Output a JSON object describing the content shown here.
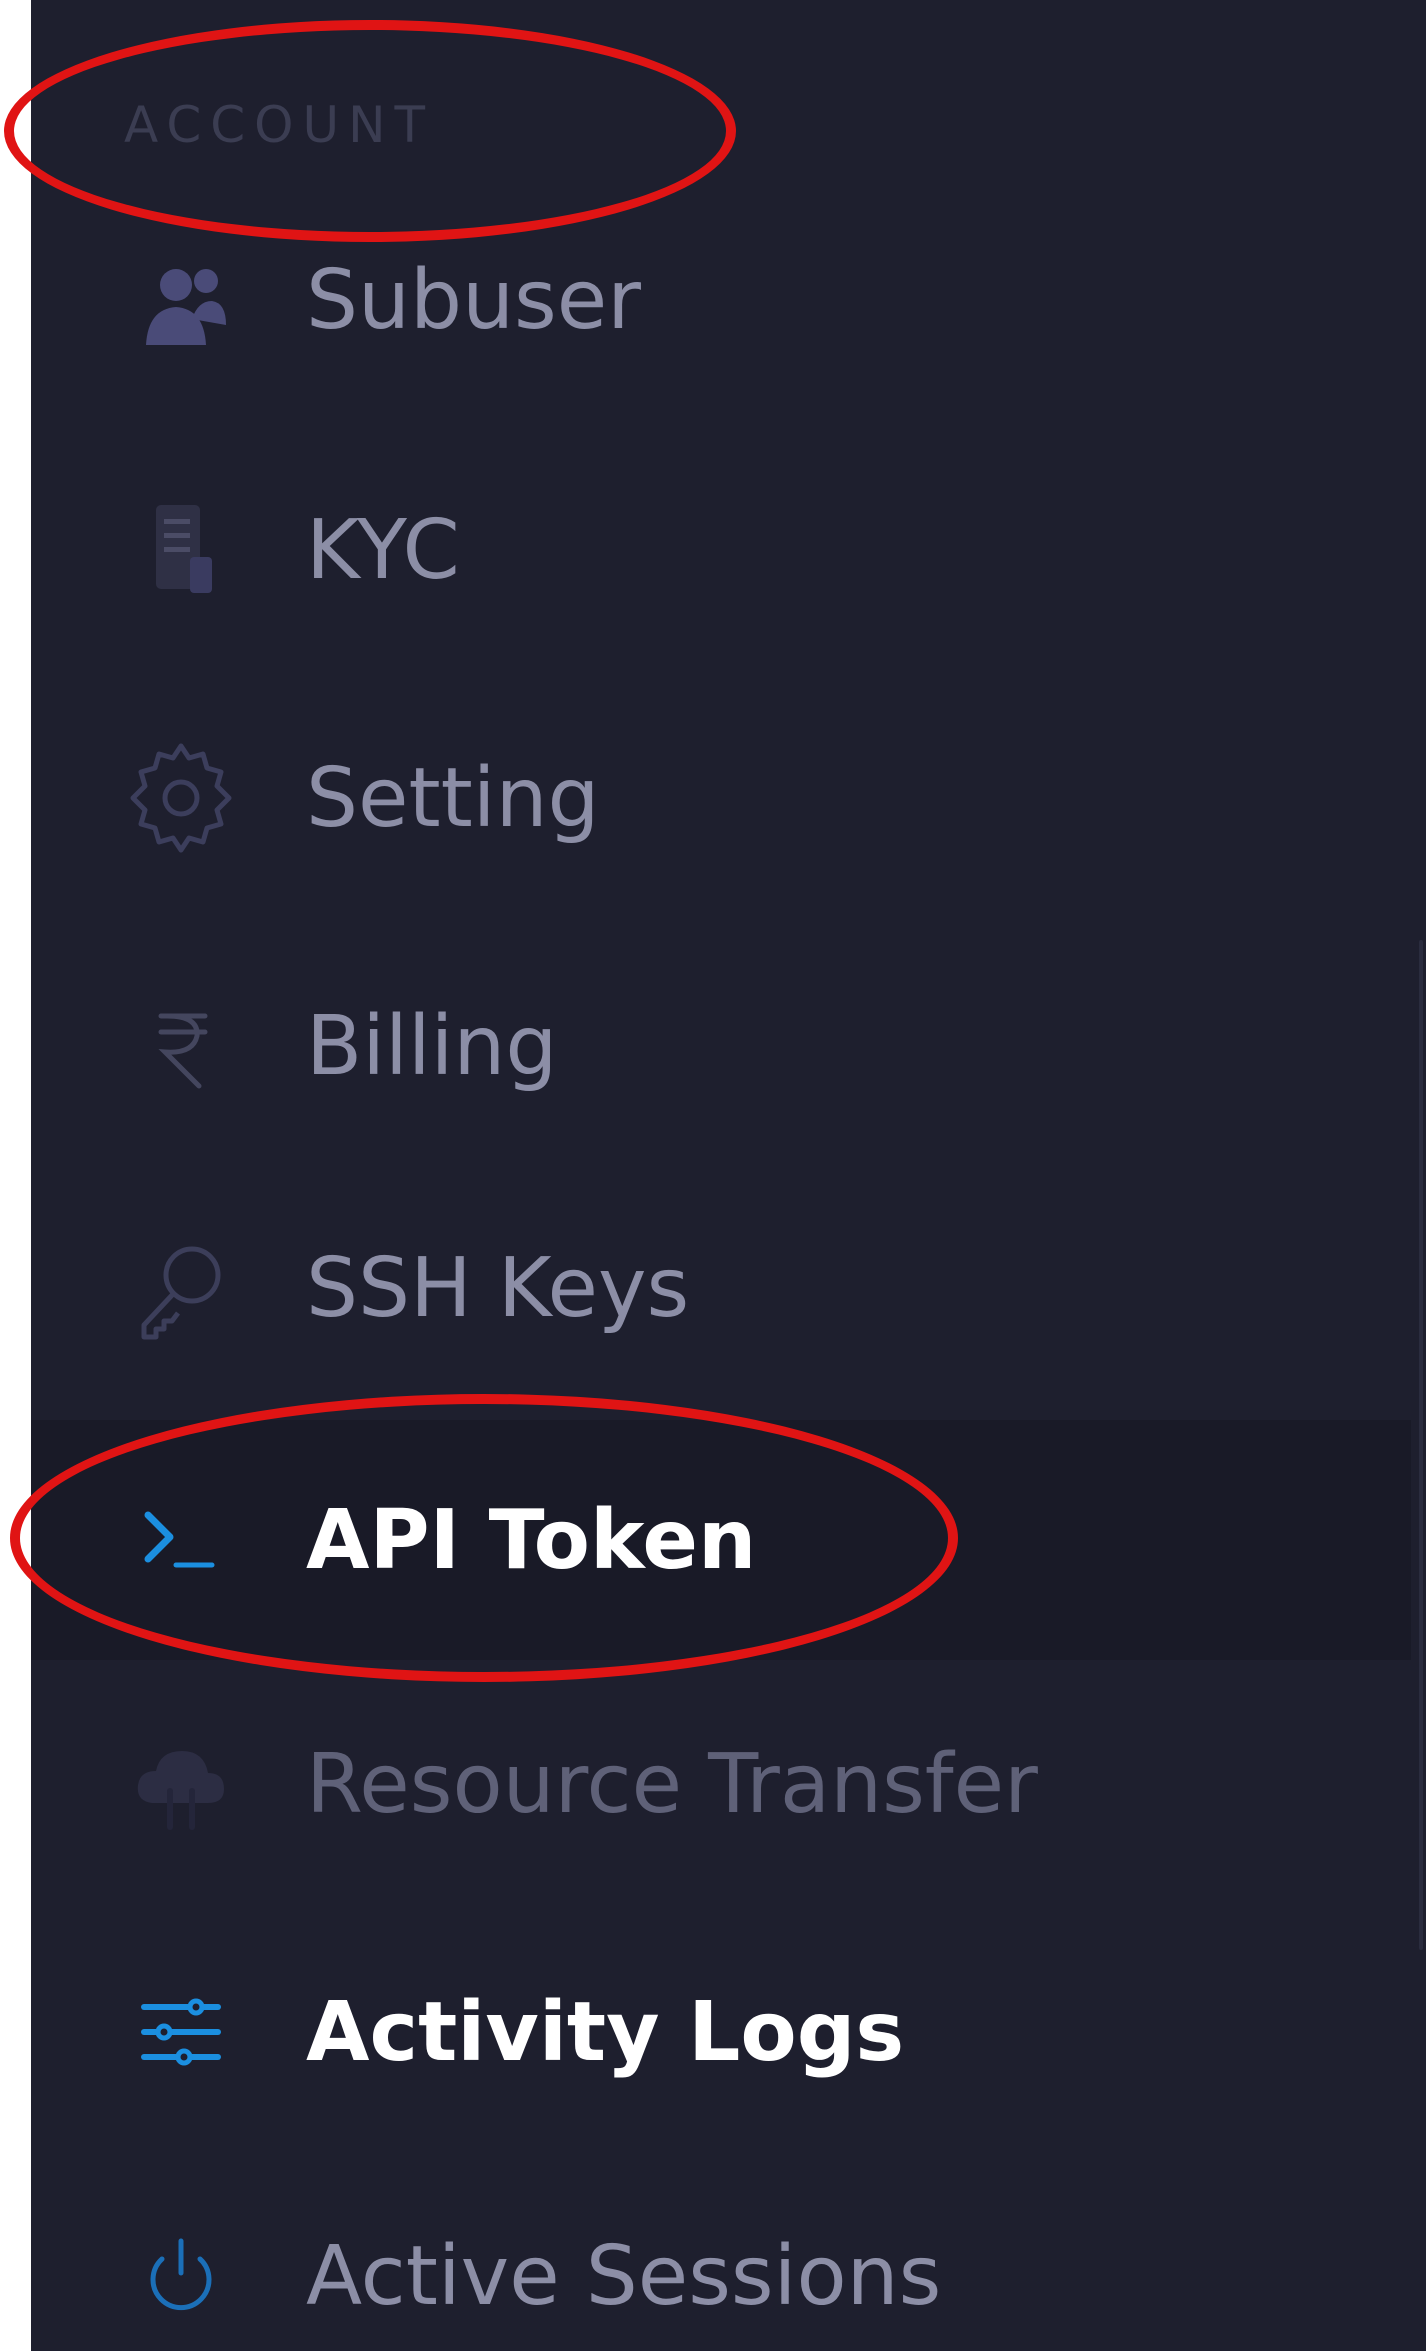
{
  "sidebar": {
    "section_title": "ACCOUNT",
    "items": [
      {
        "label": "Subuser",
        "icon": "users-icon"
      },
      {
        "label": "KYC",
        "icon": "document-icon"
      },
      {
        "label": "Setting",
        "icon": "gear-icon"
      },
      {
        "label": "Billing",
        "icon": "rupee-icon"
      },
      {
        "label": "SSH Keys",
        "icon": "key-icon"
      },
      {
        "label": "API Token",
        "icon": "terminal-icon",
        "active": true
      },
      {
        "label": "Resource Transfer",
        "icon": "cloud-transfer-icon"
      },
      {
        "label": "Activity Logs",
        "icon": "sliders-icon"
      },
      {
        "label": "Active Sessions",
        "icon": "power-icon"
      }
    ]
  },
  "colors": {
    "background": "#1e1f2e",
    "active_background": "#191a27",
    "accent": "#1b8fe0",
    "annotation": "#e01414"
  }
}
